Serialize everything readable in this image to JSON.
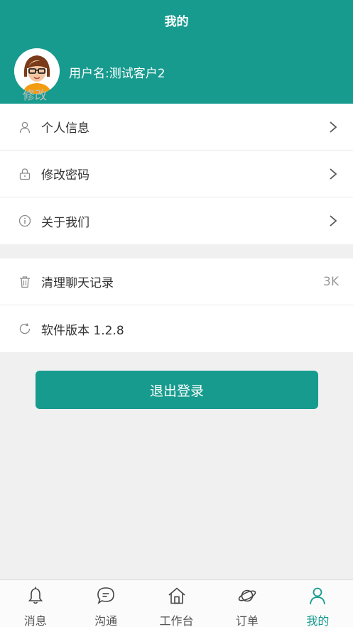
{
  "header": {
    "title": "我的",
    "username": "用户名:测试客户2",
    "avatar_edit": "修改"
  },
  "menu_group_1": [
    {
      "label": "个人信息",
      "icon": "user-icon"
    },
    {
      "label": "修改密码",
      "icon": "lock-icon"
    },
    {
      "label": "关于我们",
      "icon": "info-icon"
    }
  ],
  "menu_group_2": [
    {
      "label": "清理聊天记录",
      "icon": "trash-icon",
      "value": "3K"
    },
    {
      "label": "软件版本 1.2.8",
      "icon": "refresh-icon"
    }
  ],
  "logout_label": "退出登录",
  "tabs": [
    {
      "label": "消息",
      "icon": "bell-icon"
    },
    {
      "label": "沟通",
      "icon": "chat-icon"
    },
    {
      "label": "工作台",
      "icon": "home-icon"
    },
    {
      "label": "订单",
      "icon": "planet-icon"
    },
    {
      "label": "我的",
      "icon": "person-icon",
      "active": true
    }
  ],
  "colors": {
    "primary": "#179b8e",
    "background": "#f0f0f0",
    "text": "#333333",
    "muted": "#999999"
  }
}
